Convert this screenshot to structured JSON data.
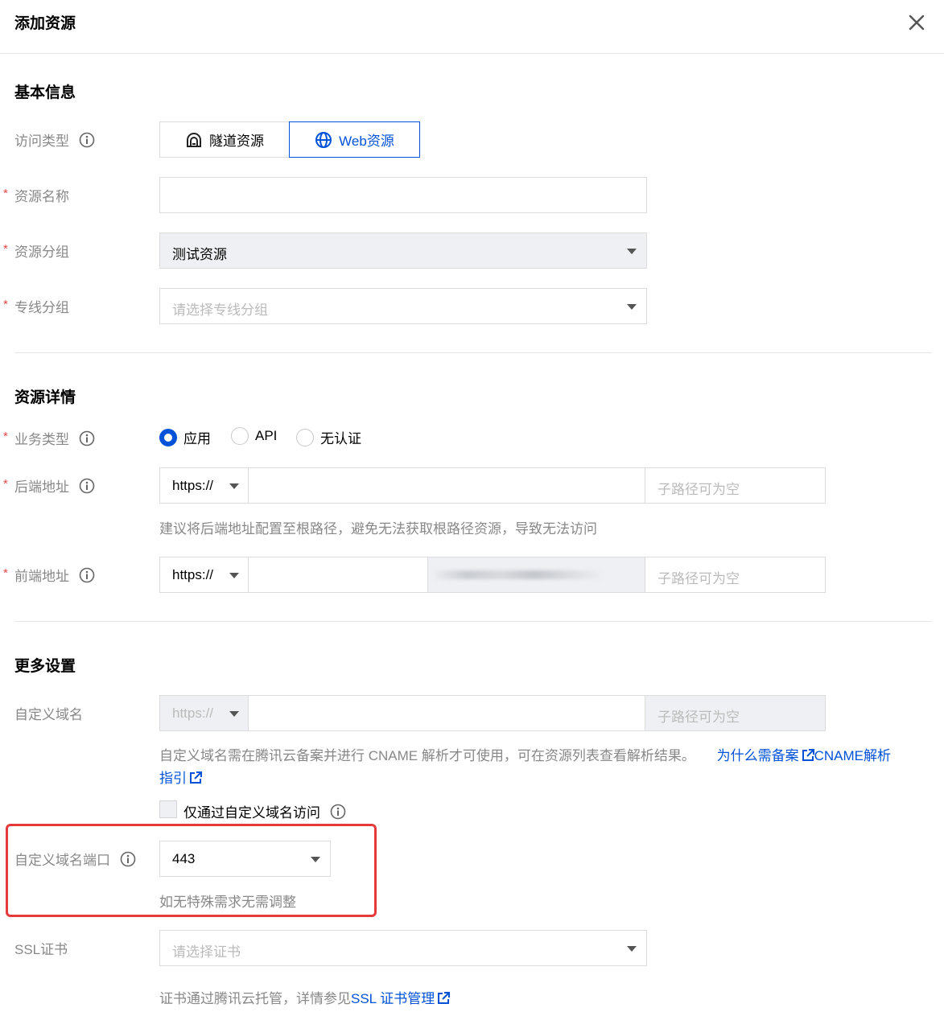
{
  "dialog": {
    "title": "添加资源"
  },
  "basic": {
    "title": "基本信息",
    "access_type": {
      "label": "访问类型",
      "options": [
        "隧道资源",
        "Web资源"
      ],
      "selected": "Web资源"
    },
    "resource_name": {
      "label": "资源名称",
      "value": ""
    },
    "resource_group": {
      "label": "资源分组",
      "value": "测试资源"
    },
    "line_group": {
      "label": "专线分组",
      "placeholder": "请选择专线分组"
    }
  },
  "details": {
    "title": "资源详情",
    "business_type": {
      "label": "业务类型",
      "options": [
        "应用",
        "API",
        "无认证"
      ],
      "selected": "应用"
    },
    "backend": {
      "label": "后端地址",
      "protocol": "https://",
      "subpath_placeholder": "子路径可为空",
      "hint": "建议将后端地址配置至根路径，避免无法获取根路径资源，导致无法访问"
    },
    "frontend": {
      "label": "前端地址",
      "protocol": "https://",
      "subpath_placeholder": "子路径可为空"
    }
  },
  "more": {
    "title": "更多设置",
    "custom_domain": {
      "label": "自定义域名",
      "protocol": "https://",
      "subpath_placeholder": "子路径可为空",
      "hint": "自定义域名需在腾讯云备案并进行 CNAME 解析才可使用，可在资源列表查看解析结果。",
      "link_why": "为什么需备案",
      "link_cname_a": "CNAME解析",
      "link_cname_b": "指引",
      "only_custom": "仅通过自定义域名访问"
    },
    "custom_port": {
      "label": "自定义域名端口",
      "value": "443",
      "hint": "如无特殊需求无需调整"
    },
    "ssl": {
      "label": "SSL证书",
      "placeholder": "请选择证书",
      "hint_prefix": "证书通过腾讯云托管，详情参见",
      "link": "SSL 证书管理"
    }
  },
  "colors": {
    "primary": "#0052d9",
    "required": "#e54545",
    "highlight": "#e5393b"
  }
}
